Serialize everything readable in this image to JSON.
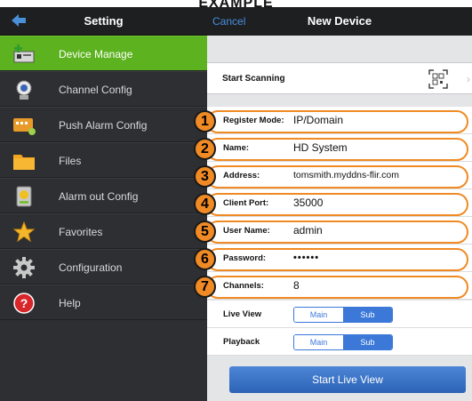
{
  "top_label": "EXAMPLE",
  "sidebar": {
    "title": "Setting",
    "back_icon": "back-arrow-icon",
    "items": [
      {
        "label": "Device Manage",
        "icon": "device-manage-icon",
        "active": true
      },
      {
        "label": "Channel Config",
        "icon": "camera-icon",
        "active": false
      },
      {
        "label": "Push Alarm Config",
        "icon": "push-alarm-icon",
        "active": false
      },
      {
        "label": "Files",
        "icon": "folder-icon",
        "active": false
      },
      {
        "label": "Alarm out Config",
        "icon": "alarm-out-icon",
        "active": false
      },
      {
        "label": "Favorites",
        "icon": "star-icon",
        "active": false
      },
      {
        "label": "Configuration",
        "icon": "gear-icon",
        "active": false
      },
      {
        "label": "Help",
        "icon": "help-icon",
        "active": false
      }
    ]
  },
  "panel": {
    "cancel_label": "Cancel",
    "title": "New Device",
    "scan_label": "Start Scanning",
    "scan_icon": "qr-code-icon",
    "fields": [
      {
        "number": "1",
        "label": "Register Mode:",
        "value": "IP/Domain"
      },
      {
        "number": "2",
        "label": "Name:",
        "value": "HD System"
      },
      {
        "number": "3",
        "label": "Address:",
        "value": "tomsmith.myddns-flir.com"
      },
      {
        "number": "4",
        "label": "Client Port:",
        "value": "35000"
      },
      {
        "number": "5",
        "label": "User Name:",
        "value": "admin"
      },
      {
        "number": "6",
        "label": "Password:",
        "value": "••••••"
      },
      {
        "number": "7",
        "label": "Channels:",
        "value": "8"
      }
    ],
    "live_view": {
      "label": "Live View",
      "options": [
        "Main",
        "Sub"
      ],
      "selected": "Sub"
    },
    "playback": {
      "label": "Playback",
      "options": [
        "Main",
        "Sub"
      ],
      "selected": "Sub"
    },
    "start_button": "Start Live View"
  },
  "colors": {
    "accent_green": "#5cb21f",
    "callout_orange": "#f08a24",
    "button_blue": "#3b78d8",
    "dark_header": "#1d1f21"
  }
}
